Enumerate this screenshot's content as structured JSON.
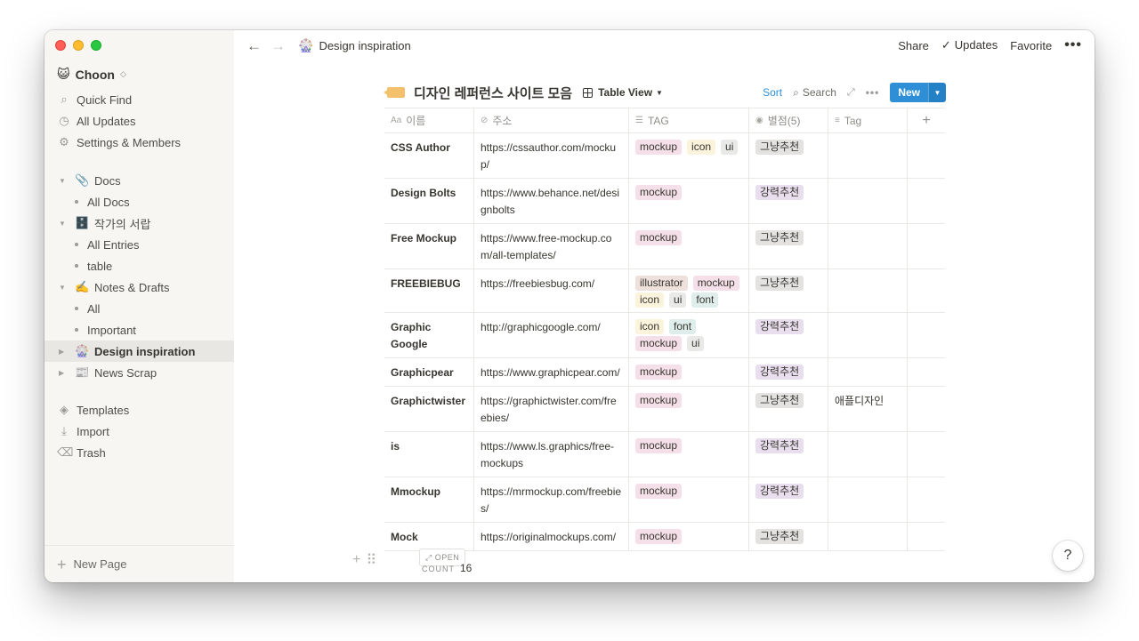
{
  "window_controls": {
    "close": "close",
    "minimize": "minimize",
    "zoom": "zoom"
  },
  "sidebar": {
    "workspace": "Choon",
    "workspace_icon": "😺",
    "top_items": [
      {
        "label": "Quick Find",
        "icon": "search-icon"
      },
      {
        "label": "All Updates",
        "icon": "clock-icon"
      },
      {
        "label": "Settings & Members",
        "icon": "gear-icon"
      }
    ],
    "tree": [
      {
        "label": "Docs",
        "emoji": "📎",
        "children": [
          "All Docs"
        ]
      },
      {
        "label": "작가의 서랍",
        "emoji": "🗄️",
        "children": [
          "All Entries",
          "table"
        ]
      },
      {
        "label": "Notes & Drafts",
        "emoji": "✍️",
        "children": [
          "All",
          "Important"
        ]
      },
      {
        "label": "Design inspiration",
        "emoji": "🎡",
        "active": true
      },
      {
        "label": "News Scrap",
        "emoji": "📰"
      }
    ],
    "bottom_items": [
      {
        "label": "Templates",
        "icon": "shapes-icon"
      },
      {
        "label": "Import",
        "icon": "download-icon"
      },
      {
        "label": "Trash",
        "icon": "trash-icon"
      }
    ],
    "new_page": "New Page"
  },
  "topbar": {
    "breadcrumb_icon": "🎡",
    "breadcrumb": "Design inspiration",
    "share": "Share",
    "updates": "Updates",
    "favorite": "Favorite",
    "more": "•••"
  },
  "database": {
    "title": "디자인 레퍼런스 사이트 모음",
    "view": "Table View",
    "sort": "Sort",
    "search": "Search",
    "new": "New",
    "columns": [
      {
        "label": "이름",
        "icon": "Aa"
      },
      {
        "label": "주소",
        "icon": "link"
      },
      {
        "label": "TAG",
        "icon": "list"
      },
      {
        "label": "별점(5)",
        "icon": "select"
      },
      {
        "label": "Tag",
        "icon": "text"
      }
    ],
    "rows": [
      {
        "name": "CSS Author",
        "url": "https://cssauthor.com/mockup/",
        "tags": [
          "mockup",
          "icon",
          "ui"
        ],
        "rating": "그냥추천",
        "tag": ""
      },
      {
        "name": "Design Bolts",
        "url": "https://www.behance.net/designbolts",
        "tags": [
          "mockup"
        ],
        "rating": "강력추천",
        "tag": ""
      },
      {
        "name": "Free Mockup",
        "url": "https://www.free-mockup.com/all-templates/",
        "tags": [
          "mockup"
        ],
        "rating": "그냥추천",
        "tag": ""
      },
      {
        "name": "FREEBIEBUG",
        "url": "https://freebiesbug.com/",
        "tags": [
          "illustrator",
          "mockup",
          "icon",
          "ui",
          "font"
        ],
        "rating": "그냥추천",
        "tag": ""
      },
      {
        "name": "Graphic Google",
        "url": "http://graphicgoogle.com/",
        "tags": [
          "icon",
          "font",
          "mockup",
          "ui"
        ],
        "rating": "강력추천",
        "tag": ""
      },
      {
        "name": "Graphicpear",
        "url": "https://www.graphicpear.com/",
        "tags": [
          "mockup"
        ],
        "rating": "강력추천",
        "tag": ""
      },
      {
        "name": "Graphictwister",
        "url": "https://graphictwister.com/freebies/",
        "tags": [
          "mockup"
        ],
        "rating": "그냥추천",
        "tag": "애플디자인"
      },
      {
        "name": "is",
        "url": "https://www.ls.graphics/free-mockups",
        "tags": [
          "mockup"
        ],
        "rating": "강력추천",
        "tag": ""
      },
      {
        "name": "Mmockup",
        "url": "https://mrmockup.com/freebies/",
        "tags": [
          "mockup"
        ],
        "rating": "강력추천",
        "tag": ""
      },
      {
        "name": "Mock",
        "url": "https://originalmockups.com/",
        "tags": [
          "mockup"
        ],
        "rating": "그냥추천",
        "tag": ""
      }
    ],
    "open_label": "OPEN",
    "count_label": "COUNT",
    "count": "16"
  },
  "colors": {
    "accent": "#2e8fd6",
    "sidebar_bg": "#f7f6f3"
  },
  "help": "?"
}
